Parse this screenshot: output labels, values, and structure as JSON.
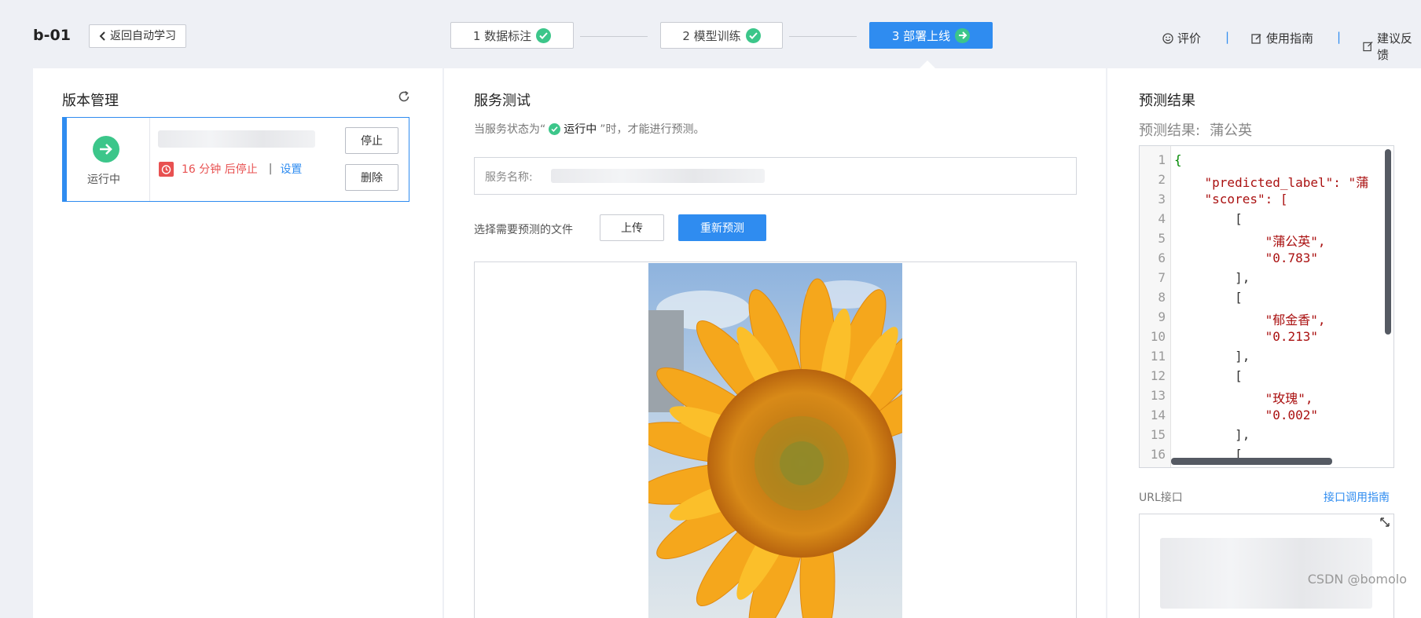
{
  "header": {
    "model_id": "b-01",
    "back_label": "返回自动学习",
    "steps": [
      {
        "label": "1 数据标注",
        "status": "done"
      },
      {
        "label": "2 模型训练",
        "status": "done"
      },
      {
        "label": "3 部署上线",
        "status": "active"
      }
    ],
    "links": {
      "rate": "评价",
      "guide": "使用指南",
      "feedback": "建议反馈"
    },
    "separator": "|"
  },
  "version_panel": {
    "title": "版本管理",
    "status_text": "运行中",
    "countdown": "16 分钟 后停止",
    "separator": "|",
    "settings_link": "设置",
    "stop_button": "停止",
    "delete_button": "删除"
  },
  "service_panel": {
    "title": "服务测试",
    "hint_prefix": "当服务状态为“",
    "hint_status": "运行中",
    "hint_suffix": "”时，才能进行预测。",
    "service_name_label": "服务名称:",
    "file_label": "选择需要预测的文件",
    "upload_button": "上传",
    "repredict_button": "重新预测"
  },
  "result_panel": {
    "title": "预测结果",
    "result_label": "预测结果:",
    "result_value": "蒲公英",
    "json_lines": [
      "{",
      "    \"predicted_label\": \"蒲",
      "    \"scores\": [",
      "        [",
      "            \"蒲公英\",",
      "            \"0.783\"",
      "        ],",
      "        [",
      "            \"郁金香\",",
      "            \"0.213\"",
      "        ],",
      "        [",
      "            \"玫瑰\",",
      "            \"0.002\"",
      "        ],",
      "        ["
    ],
    "line_numbers": [
      "1",
      "2",
      "3",
      "4",
      "5",
      "6",
      "7",
      "8",
      "9",
      "10",
      "11",
      "12",
      "13",
      "14",
      "15",
      "16"
    ],
    "url_label": "URL接口",
    "api_guide_link": "接口调用指南"
  },
  "watermark": "CSDN @bomolo",
  "colors": {
    "primary": "#2f8cf0",
    "success": "#3cc68a",
    "danger": "#e85151",
    "background": "#eef0f5"
  },
  "icons": [
    "chevron-left-icon",
    "check-circle-icon",
    "arrow-right-circle-icon",
    "smile-icon",
    "edit-doc-icon",
    "feedback-icon",
    "refresh-icon",
    "timer-icon",
    "expand-icon"
  ]
}
